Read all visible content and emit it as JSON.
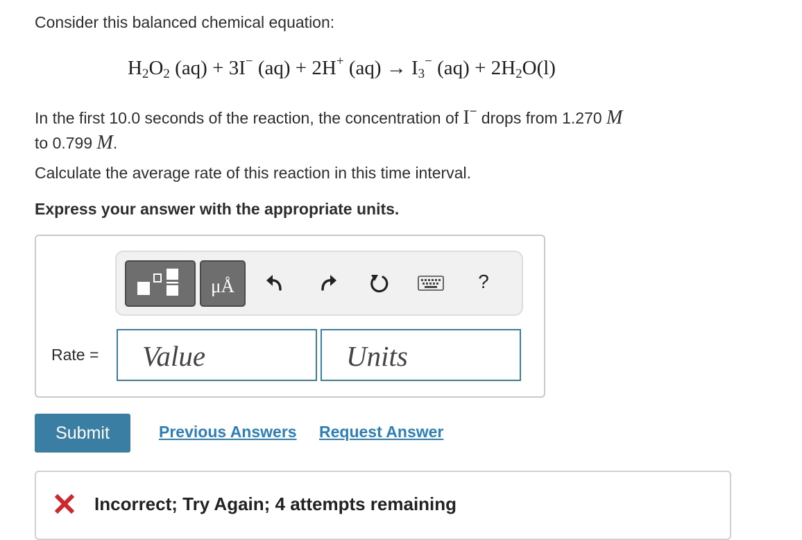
{
  "question": {
    "intro": "Consider this balanced chemical equation:",
    "equation": {
      "h2o2": "H",
      "h2o2_sub1": "2",
      "h2o2_o": "O",
      "h2o2_sub2": "2",
      "h2o2_phase": "(aq)",
      "plus1": " + ",
      "iodide_coef": "3I",
      "iodide_charge": "−",
      "iodide_phase": "(aq)",
      "plus2": " + ",
      "hplus": "2H",
      "hplus_charge": "+",
      "hplus_phase": "(aq)",
      "arrow": " → ",
      "i3": "I",
      "i3_sub": "3",
      "i3_charge": "−",
      "i3_phase": "(aq)",
      "plus3": " + ",
      "water": "2H",
      "water_sub": "2",
      "water_o": "O",
      "water_phase": "(l)"
    },
    "para_part1": "In the first 10.0 seconds of the reaction, the concentration of ",
    "para_ion": "I",
    "para_ion_charge": "−",
    "para_part2": " drops from 1.270 ",
    "para_unit1": "M",
    "para_part3": "to 0.799 ",
    "para_unit2": "M",
    "para_end": ".",
    "calculate": "Calculate the average rate of this reaction in this time interval.",
    "express": "Express your answer with the appropriate units."
  },
  "toolbar": {
    "units_button": "μÅ",
    "icons": [
      "template-icon",
      "units-icon",
      "undo-icon",
      "redo-icon",
      "reset-icon",
      "keyboard-icon",
      "help-icon"
    ],
    "help": "?"
  },
  "answer": {
    "label": "Rate =",
    "value_placeholder": "Value",
    "units_placeholder": "Units"
  },
  "actions": {
    "submit": "Submit",
    "previous_answers": "Previous Answers",
    "request_answer": "Request Answer"
  },
  "feedback": {
    "message": "Incorrect; Try Again; 4 attempts remaining",
    "status_color": "#d0262d"
  },
  "colors": {
    "accent": "#3a7fa3",
    "link": "#2c7fb8"
  }
}
